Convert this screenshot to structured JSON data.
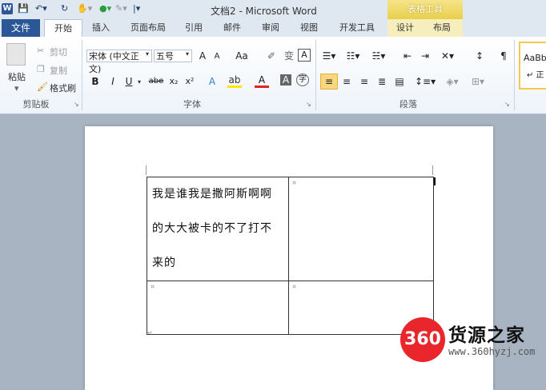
{
  "title_bar": {
    "app_logo": "W",
    "doc_title": "文档2 - Microsoft Word",
    "context_header": "表格工具"
  },
  "tabs": [
    {
      "label": "文件"
    },
    {
      "label": "开始"
    },
    {
      "label": "插入"
    },
    {
      "label": "页面布局"
    },
    {
      "label": "引用"
    },
    {
      "label": "邮件"
    },
    {
      "label": "审阅"
    },
    {
      "label": "视图"
    },
    {
      "label": "开发工具"
    },
    {
      "label": "设计"
    },
    {
      "label": "布局"
    }
  ],
  "clipboard": {
    "paste": "粘贴",
    "cut": "剪切",
    "copy": "复制",
    "format_painter": "格式刷",
    "group_label": "剪贴板"
  },
  "font": {
    "font_name": "宋体 (中文正文)",
    "font_size": "五号",
    "grow": "A",
    "shrink": "A",
    "change_case": "Aa",
    "bold": "B",
    "italic": "I",
    "underline": "U",
    "strike": "abe",
    "subscript": "x₂",
    "superscript": "x²",
    "font_color": "A",
    "char_shading": "A",
    "group_label": "字体"
  },
  "paragraph": {
    "group_label": "段落"
  },
  "styles": {
    "sample": "AaBb",
    "sample_sub": "↵ 正"
  },
  "document": {
    "cell1_lines": [
      "我是谁我是撒阿斯啊啊",
      "的大大被卡的不了打不",
      "来的"
    ]
  },
  "watermark": {
    "logo_text": "360",
    "title": "货源之家",
    "url": "www.360hyzj.com"
  },
  "colors": {
    "file_tab": "#2b5797",
    "context_tab": "#e9cf4c",
    "watermark_red": "#e8262c"
  }
}
